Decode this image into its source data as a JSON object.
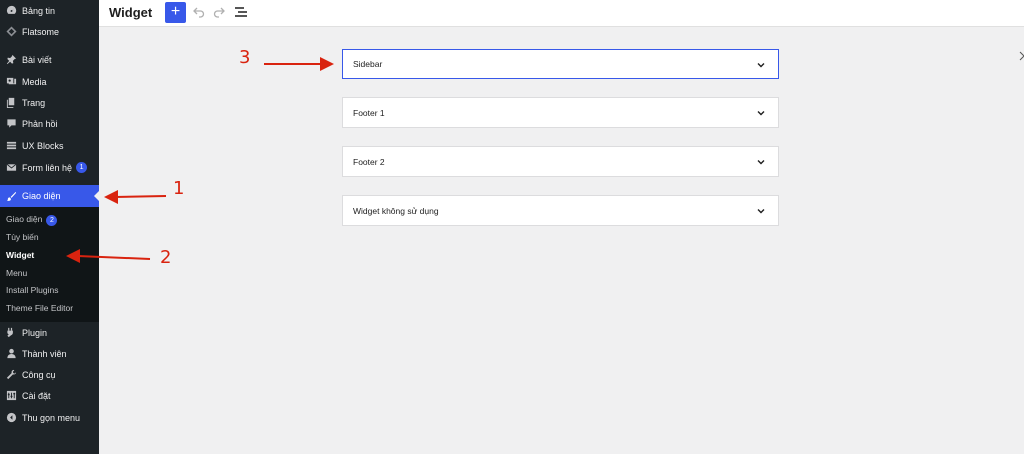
{
  "sidebar": {
    "items": [
      {
        "label": "Bảng tin",
        "icon": "dashboard-icon"
      },
      {
        "label": "Flatsome",
        "icon": "flatsome-icon"
      },
      {
        "label": "Bài viết",
        "icon": "pin-icon"
      },
      {
        "label": "Media",
        "icon": "media-icon"
      },
      {
        "label": "Trang",
        "icon": "page-icon"
      },
      {
        "label": "Phản hồi",
        "icon": "comment-icon"
      },
      {
        "label": "UX Blocks",
        "icon": "blocks-icon"
      },
      {
        "label": "Form liên hệ",
        "icon": "mail-icon",
        "badge": "1"
      },
      {
        "label": "Giao diện",
        "icon": "brush-icon"
      },
      {
        "label": "Plugin",
        "icon": "plugin-icon"
      },
      {
        "label": "Thành viên",
        "icon": "user-icon"
      },
      {
        "label": "Công cụ",
        "icon": "wrench-icon"
      },
      {
        "label": "Cài đặt",
        "icon": "settings-icon"
      },
      {
        "label": "Thu gọn menu",
        "icon": "collapse-icon"
      }
    ],
    "submenu": [
      {
        "label": "Giao diện",
        "badge": "2"
      },
      {
        "label": "Tùy biến"
      },
      {
        "label": "Widget"
      },
      {
        "label": "Menu"
      },
      {
        "label": "Install Plugins"
      },
      {
        "label": "Theme File Editor"
      }
    ]
  },
  "header": {
    "title": "Widget",
    "add_label": "+"
  },
  "widget_areas": [
    {
      "label": "Sidebar"
    },
    {
      "label": "Footer 1"
    },
    {
      "label": "Footer 2"
    },
    {
      "label": "Widget không sử dụng"
    }
  ],
  "annotations": [
    "1",
    "2",
    "3"
  ],
  "colors": {
    "accent": "#3858e9",
    "annotation": "#d9230f",
    "sidebar_bg": "#1d2327"
  }
}
